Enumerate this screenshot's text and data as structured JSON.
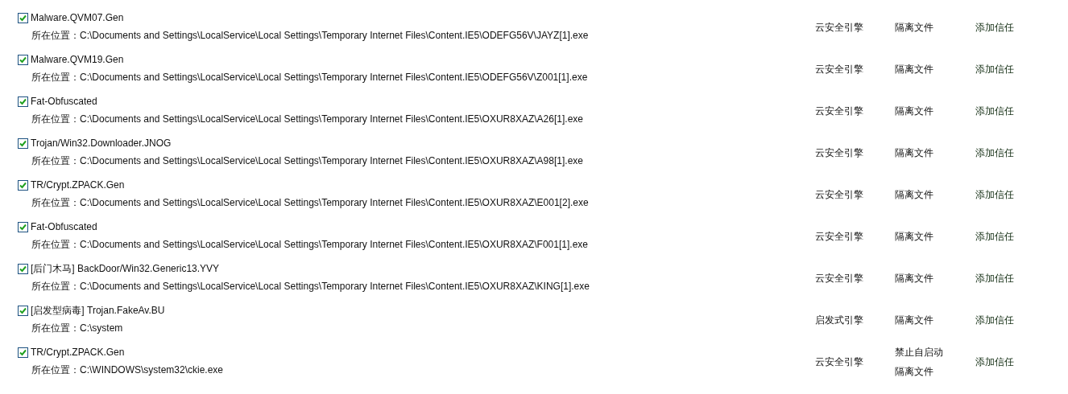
{
  "threats": [
    {
      "checked": true,
      "name": "Malware.QVM07.Gen",
      "location_label": "所在位置：",
      "path": "C:\\Documents and Settings\\LocalService\\Local Settings\\Temporary Internet Files\\Content.IE5\\ODEFG56V\\JAYZ[1].exe",
      "engine": "云安全引擎",
      "actions": [
        "隔离文件"
      ],
      "trust": "添加信任"
    },
    {
      "checked": true,
      "name": "Malware.QVM19.Gen",
      "location_label": "所在位置：",
      "path": "C:\\Documents and Settings\\LocalService\\Local Settings\\Temporary Internet Files\\Content.IE5\\ODEFG56V\\Z001[1].exe",
      "engine": "云安全引擎",
      "actions": [
        "隔离文件"
      ],
      "trust": "添加信任"
    },
    {
      "checked": true,
      "name": "Fat-Obfuscated",
      "location_label": "所在位置：",
      "path": "C:\\Documents and Settings\\LocalService\\Local Settings\\Temporary Internet Files\\Content.IE5\\OXUR8XAZ\\A26[1].exe",
      "engine": "云安全引擎",
      "actions": [
        "隔离文件"
      ],
      "trust": "添加信任"
    },
    {
      "checked": true,
      "name": "Trojan/Win32.Downloader.JNOG",
      "location_label": "所在位置：",
      "path": "C:\\Documents and Settings\\LocalService\\Local Settings\\Temporary Internet Files\\Content.IE5\\OXUR8XAZ\\A98[1].exe",
      "engine": "云安全引擎",
      "actions": [
        "隔离文件"
      ],
      "trust": "添加信任"
    },
    {
      "checked": true,
      "name": "TR/Crypt.ZPACK.Gen",
      "location_label": "所在位置：",
      "path": "C:\\Documents and Settings\\LocalService\\Local Settings\\Temporary Internet Files\\Content.IE5\\OXUR8XAZ\\E001[2].exe",
      "engine": "云安全引擎",
      "actions": [
        "隔离文件"
      ],
      "trust": "添加信任"
    },
    {
      "checked": true,
      "name": "Fat-Obfuscated",
      "location_label": "所在位置：",
      "path": "C:\\Documents and Settings\\LocalService\\Local Settings\\Temporary Internet Files\\Content.IE5\\OXUR8XAZ\\F001[1].exe",
      "engine": "云安全引擎",
      "actions": [
        "隔离文件"
      ],
      "trust": "添加信任"
    },
    {
      "checked": true,
      "name": "[后门木马] BackDoor/Win32.Generic13.YVY",
      "location_label": "所在位置：",
      "path": "C:\\Documents and Settings\\LocalService\\Local Settings\\Temporary Internet Files\\Content.IE5\\OXUR8XAZ\\KING[1].exe",
      "engine": "云安全引擎",
      "actions": [
        "隔离文件"
      ],
      "trust": "添加信任"
    },
    {
      "checked": true,
      "name": "[启发型病毒] Trojan.FakeAv.BU",
      "location_label": "所在位置：",
      "path": "C:\\system",
      "engine": "启发式引擎",
      "actions": [
        "隔离文件"
      ],
      "trust": "添加信任"
    },
    {
      "checked": true,
      "name": "TR/Crypt.ZPACK.Gen",
      "location_label": "所在位置：",
      "path": "C:\\WINDOWS\\system32\\ckie.exe",
      "engine": "云安全引擎",
      "actions": [
        "禁止自启动",
        "隔离文件"
      ],
      "trust": "添加信任"
    }
  ]
}
